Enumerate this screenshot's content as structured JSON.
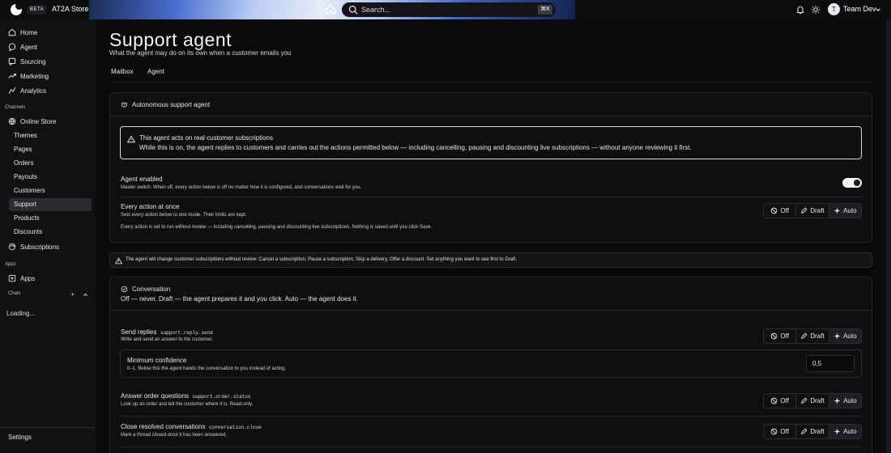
{
  "topbar": {
    "beta": "BETA",
    "store_name": "AT2A Store",
    "search_placeholder": "Search...",
    "shortcut": "⌘K",
    "user_initial": "T",
    "user_name": "Team Dev"
  },
  "sidebar": {
    "main_items": [
      {
        "label": "Home",
        "icon": "home-icon"
      },
      {
        "label": "Agent",
        "icon": "chat-bubble-icon"
      },
      {
        "label": "Sourcing",
        "icon": "message-square-icon"
      },
      {
        "label": "Marketing",
        "icon": "trending-up-icon"
      },
      {
        "label": "Analytics",
        "icon": "analytics-icon"
      }
    ],
    "channels_label": "Channels",
    "channel_name": "Online Store",
    "channel_items": [
      "Themes",
      "Pages",
      "Orders",
      "Payouts",
      "Customers",
      "Support",
      "Products",
      "Discounts"
    ],
    "subscriptions": "Subscriptions",
    "apps_label": "Apps",
    "apps_item": "Apps",
    "chats_label": "Chats",
    "chats_add": "+",
    "loading": "Loading...",
    "settings": "Settings"
  },
  "page": {
    "title": "Support agent",
    "subtitle": "What the agent may do on its own when a customer emails you",
    "tabs": [
      "Mailbox",
      "Agent"
    ],
    "active_tab": "Agent"
  },
  "autonomous": {
    "header": "Autonomous support agent",
    "warning_title": "This agent acts on real customer subscriptions",
    "warning_body": "While this is on, the agent replies to customers and carries out the actions permitted below — including cancelling, pausing and discounting live subscriptions — without anyone reviewing it first.",
    "enabled_title": "Agent enabled",
    "enabled_desc": "Master switch. When off, every action below is off no matter how it is configured, and conversations wait for you.",
    "enabled": true,
    "every_action_title": "Every action at once",
    "every_action_desc": "Sets every action below to one mode. Their limits are kept.",
    "every_action_status": "Every action is set to run without review — including cancelling, pausing and discounting live subscriptions. Nothing is saved until you click Save."
  },
  "modes": {
    "off": "Off",
    "draft": "Draft",
    "auto": "Auto"
  },
  "note": "The agent will change customer subscriptions without review: Cancel a subscription, Pause a subscription, Skip a delivery, Offer a discount. Set anything you want to see first to Draft.",
  "conversation": {
    "header": "Conversation",
    "legend": "Off — never. Draft — the agent prepares it and you click. Auto — the agent does it.",
    "rows": [
      {
        "title": "Send replies",
        "code": "support.reply.send",
        "desc": "Write and send an answer to the customer.",
        "mode": "Auto"
      },
      {
        "title": "Answer order questions",
        "code": "support.order.status",
        "desc": "Look up an order and tell the customer where it is. Read-only.",
        "mode": "Auto"
      },
      {
        "title": "Close resolved conversations",
        "code": "conversation.close",
        "desc": "Mark a thread closed once it has been answered.",
        "mode": "Auto"
      }
    ],
    "confidence_title": "Minimum confidence",
    "confidence_desc": "0–1. Below this the agent hands the conversation to you instead of acting.",
    "confidence_value": "0,5"
  }
}
